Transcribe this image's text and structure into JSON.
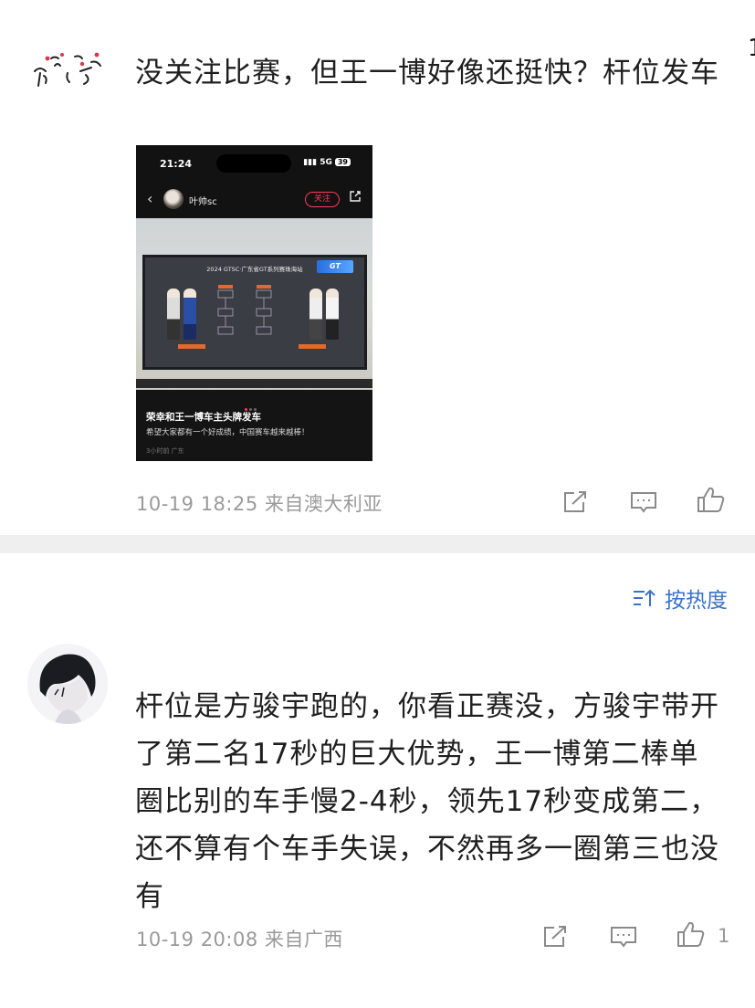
{
  "post": {
    "text": "没关注比赛，但王一博好像还挺快？杆位发车",
    "timestamp": "10-19 18:25",
    "location": "来自澳大利亚",
    "icons": [
      "share-icon",
      "comment-icon",
      "like-icon"
    ]
  },
  "embedded_screenshot": {
    "status_time": "21:24",
    "network": "5G",
    "battery": "39",
    "username": "叶帅sc",
    "follow_label": "关注",
    "board_title": "2024 GTSC·广东省GT系列赛珠海站",
    "logo_text": "GT",
    "caption_title": "荣幸和王一博车主头牌发车",
    "caption_desc": "希望大家都有一个好成绩，中国赛车越来越棒！",
    "caption_meta": "3小时前 广东"
  },
  "sort": {
    "label": "按热度",
    "icon": "sort-icon"
  },
  "reply": {
    "text": "杆位是方骏宇跑的，你看正赛没，方骏宇带开了第二名17秒的巨大优势，王一博第二棒单圈比别的车手慢2-4秒，领先17秒变成第二，还不算有个车手失误，不然再多一圈第三也没有",
    "timestamp": "10-19 20:08",
    "location": "来自广西",
    "like_count": "1"
  },
  "colors": {
    "link_blue": "#3a72c9",
    "meta_gray": "#9a9a9a",
    "follow_red": "#ff3b5b",
    "separator": "#efefef"
  }
}
